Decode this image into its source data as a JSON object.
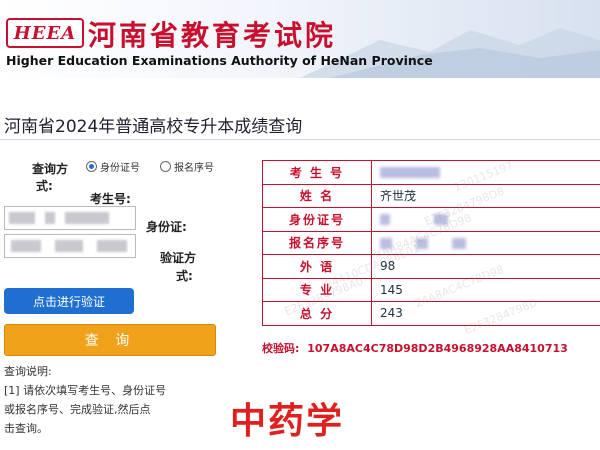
{
  "header": {
    "logo": "HEEA",
    "org_name_cn": "河南省教育考试院",
    "org_name_en": "Higher Education Examinations Authority of HeNan Province"
  },
  "page_title": "河南省2024年普通高校专升本成绩查询",
  "form": {
    "query_method_label_1": "查询方",
    "query_method_label_2": "式:",
    "option_id": "身份证号",
    "option_reg": "报名序号",
    "selected_option": "身份证号",
    "exam_no_label": "考生号:",
    "id_label": "身份证:",
    "verify_method_label_1": "验证方",
    "verify_method_label_2": "式:",
    "verify_button": "点击进行验证",
    "query_button": "查 询"
  },
  "notes": {
    "title": "查询说明:",
    "line1": "[1] 请依次填写考生号、身份证号",
    "line2": "或报名序号、完成验证,然后点",
    "line3": "击查询。"
  },
  "results": {
    "rows": [
      {
        "label": "考 生 号",
        "value": ""
      },
      {
        "label": "姓    名",
        "value": "齐世茂"
      },
      {
        "label": "身份证号",
        "value": ""
      },
      {
        "label": "报名序号",
        "value": ""
      },
      {
        "label": "外    语",
        "value": "98"
      },
      {
        "label": "专    业",
        "value": "145"
      },
      {
        "label": "总    分",
        "value": "243"
      }
    ],
    "checksum_label": "校验码:",
    "checksum_value": "107A8AC4C78D98D2B4968928AA8410713"
  },
  "overlay_text": "中药学",
  "colors": {
    "brand_red": "#c8102e",
    "verify_button": "#1f6fd1",
    "query_button": "#f0a21a"
  }
}
